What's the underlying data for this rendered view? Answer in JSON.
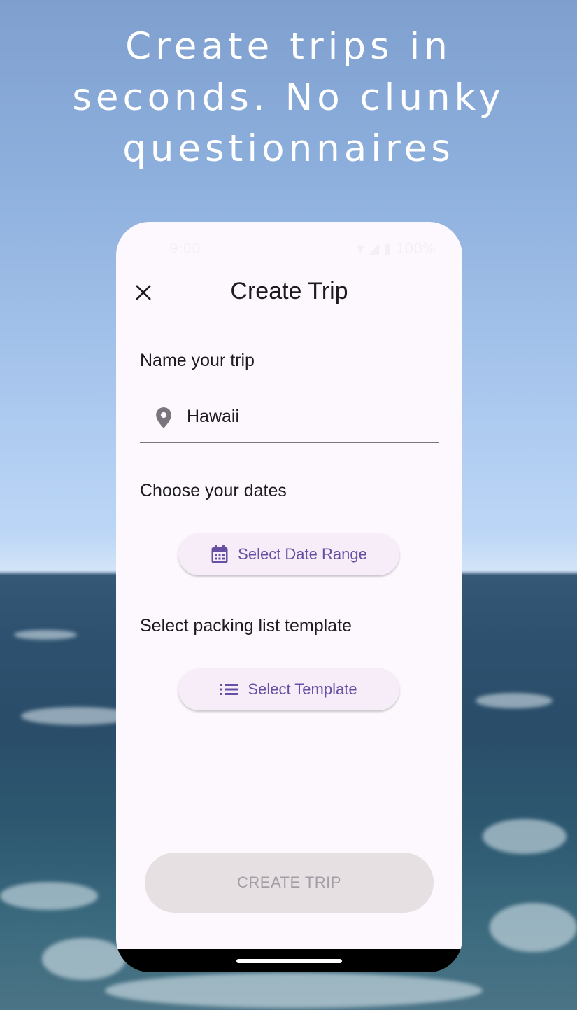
{
  "headline": [
    "Create trips in",
    "seconds. No clunky",
    "questionnaires"
  ],
  "status_bar": {
    "time": "9:00",
    "battery": "100%"
  },
  "app_bar": {
    "title": "Create Trip",
    "close_icon": "close-icon"
  },
  "name_section": {
    "label": "Name your trip",
    "icon": "location-pin-icon",
    "value": "Hawaii"
  },
  "dates_section": {
    "label": "Choose your dates",
    "button_label": "Select Date Range",
    "icon": "calendar-icon"
  },
  "template_section": {
    "label": "Select packing list template",
    "button_label": "Select Template",
    "icon": "list-icon"
  },
  "create_button": {
    "label": "CREATE TRIP",
    "enabled": false
  },
  "colors": {
    "primary": "#6750a4",
    "surface": "#fcf8fd",
    "tonal_button": "#f7edf9",
    "disabled_button": "#e6e0e3",
    "disabled_text": "#a39ea5"
  }
}
